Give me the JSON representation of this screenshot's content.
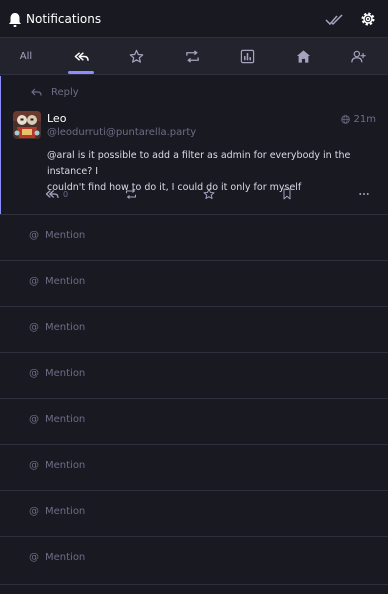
{
  "header": {
    "title": "Notifications",
    "icons": [
      "bell-icon",
      "check-all-icon",
      "gear-icon"
    ]
  },
  "tabs": [
    {
      "label": "All",
      "icon": null,
      "active": false
    },
    {
      "label": "",
      "icon": "reply-all-icon",
      "active": true
    },
    {
      "label": "",
      "icon": "star-icon",
      "active": false
    },
    {
      "label": "",
      "icon": "retweet-icon",
      "active": false
    },
    {
      "label": "",
      "icon": "poll-icon",
      "active": false
    },
    {
      "label": "",
      "icon": "home-icon",
      "active": false
    },
    {
      "label": "",
      "icon": "user-plus-icon",
      "active": false
    }
  ],
  "status": {
    "prepend": "Reply",
    "display_name": "Leo",
    "acct": "@leodurruti@puntarella.party",
    "time": "21m",
    "visibility_icon": "globe-icon",
    "content_line1": "@aral is it possible to add a filter as admin for everybody in the instance? I",
    "content_line2": "couldn't find how to do it, I could do it only for myself",
    "reply_count": "0",
    "actions": [
      "reply-all-icon",
      "retweet-icon",
      "star-icon",
      "bookmark-icon",
      "ellipsis-icon"
    ]
  },
  "mentions": [
    {
      "at": "@",
      "label": "Mention"
    },
    {
      "at": "@",
      "label": "Mention"
    },
    {
      "at": "@",
      "label": "Mention"
    },
    {
      "at": "@",
      "label": "Mention"
    },
    {
      "at": "@",
      "label": "Mention"
    },
    {
      "at": "@",
      "label": "Mention"
    },
    {
      "at": "@",
      "label": "Mention"
    },
    {
      "at": "@",
      "label": "Mention"
    }
  ],
  "colors": {
    "background": "#191922",
    "tab_bar": "#23232e",
    "accent": "#8c8dff",
    "muted_text": "#6f6c86",
    "divider": "#2f2f3d"
  }
}
